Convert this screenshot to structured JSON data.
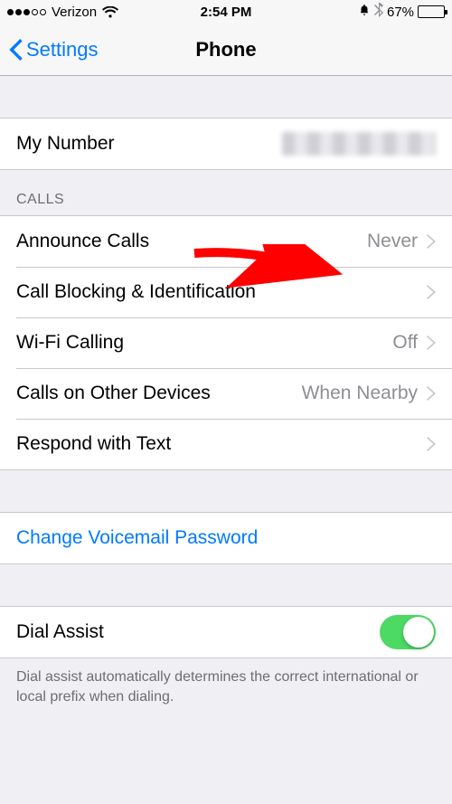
{
  "status": {
    "carrier": "Verizon",
    "time": "2:54 PM",
    "battery_pct": "67%",
    "battery_fill_pct": 67
  },
  "nav": {
    "back_label": "Settings",
    "title": "Phone"
  },
  "my_number": {
    "label": "My Number"
  },
  "sections": {
    "calls_header": "CALLS",
    "announce": {
      "label": "Announce Calls",
      "value": "Never"
    },
    "blocking": {
      "label": "Call Blocking & Identification"
    },
    "wifi_calling": {
      "label": "Wi-Fi Calling",
      "value": "Off"
    },
    "other_devices": {
      "label": "Calls on Other Devices",
      "value": "When Nearby"
    },
    "respond": {
      "label": "Respond with Text"
    },
    "voicemail": {
      "label": "Change Voicemail Password"
    },
    "dial_assist": {
      "label": "Dial Assist",
      "on": true
    },
    "dial_assist_footer": "Dial assist automatically determines the correct international or local prefix when dialing."
  }
}
